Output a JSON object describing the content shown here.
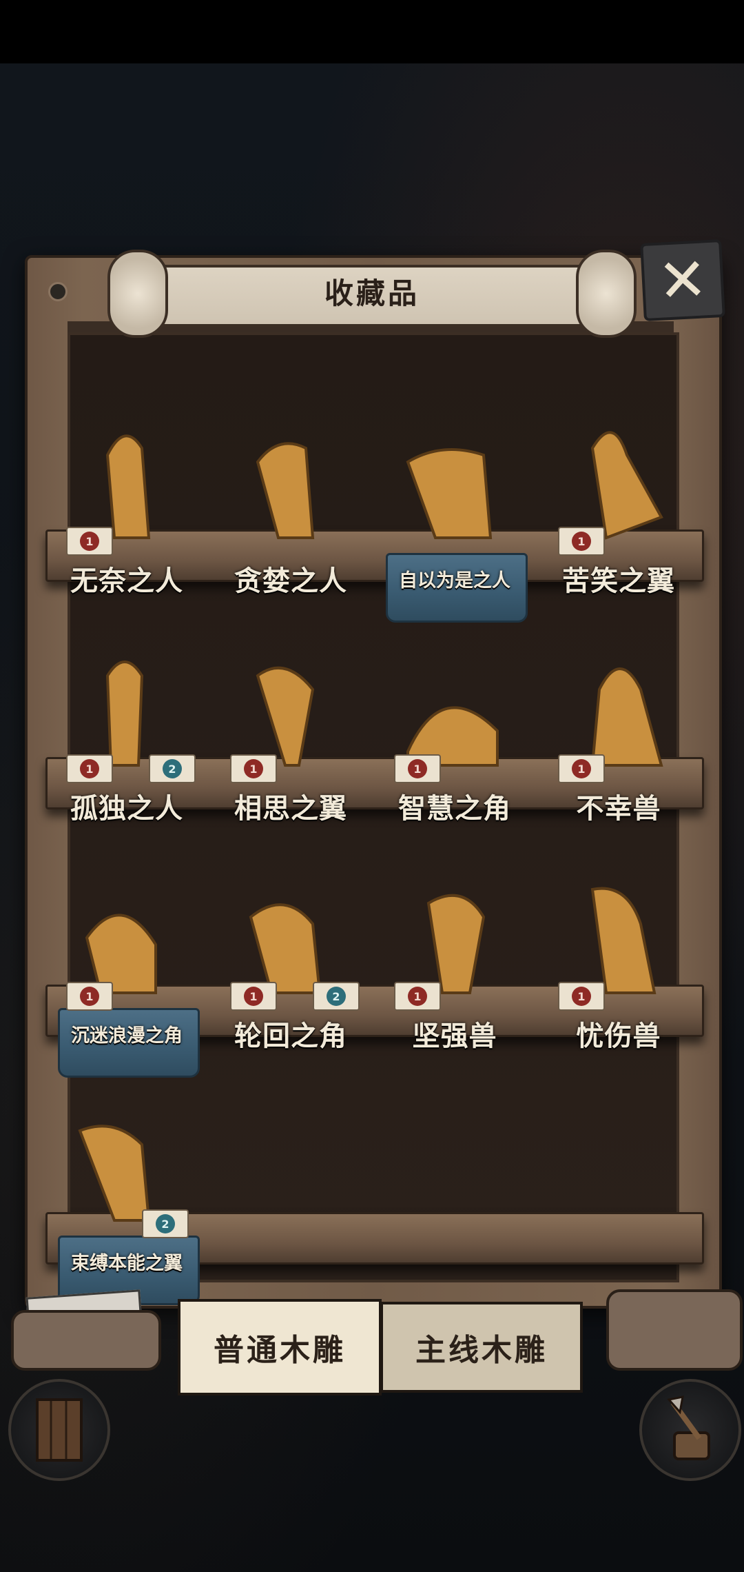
{
  "window": {
    "title": "收藏品"
  },
  "tabs": [
    {
      "label": "普通木雕",
      "active": true
    },
    {
      "label": "主线木雕",
      "active": false
    }
  ],
  "items": [
    {
      "name": "无奈之人",
      "badges": [
        {
          "kind": "red",
          "count": "1"
        }
      ],
      "plate": false
    },
    {
      "name": "贪婪之人",
      "badges": [],
      "plate": false
    },
    {
      "name": "自以为是之人",
      "badges": [],
      "plate": true
    },
    {
      "name": "苦笑之翼",
      "badges": [
        {
          "kind": "red",
          "count": "1"
        }
      ],
      "plate": false
    },
    {
      "name": "孤独之人",
      "badges": [
        {
          "kind": "red",
          "count": "1"
        },
        {
          "kind": "blue",
          "count": "2"
        }
      ],
      "plate": false
    },
    {
      "name": "相思之翼",
      "badges": [
        {
          "kind": "red",
          "count": "1"
        }
      ],
      "plate": false
    },
    {
      "name": "智慧之角",
      "badges": [
        {
          "kind": "red",
          "count": "1"
        }
      ],
      "plate": false
    },
    {
      "name": "不幸兽",
      "badges": [
        {
          "kind": "red",
          "count": "1"
        }
      ],
      "plate": false
    },
    {
      "name": "沉迷浪漫之角",
      "badges": [
        {
          "kind": "red",
          "count": "1"
        }
      ],
      "plate": true
    },
    {
      "name": "轮回之角",
      "badges": [
        {
          "kind": "red",
          "count": "1"
        },
        {
          "kind": "blue",
          "count": "2"
        }
      ],
      "plate": false
    },
    {
      "name": "坚强兽",
      "badges": [
        {
          "kind": "red",
          "count": "1"
        }
      ],
      "plate": false
    },
    {
      "name": "忧伤兽",
      "badges": [
        {
          "kind": "red",
          "count": "1"
        }
      ],
      "plate": false
    },
    {
      "name": "束缚本能之翼",
      "badges": [
        {
          "kind": "blue",
          "count": "2"
        }
      ],
      "plate": true
    }
  ],
  "icons": {
    "close": "close-icon",
    "door": "door-icon",
    "axe": "axe-stump-icon"
  },
  "colors": {
    "wood": "#715b48",
    "statue": "#c9903f",
    "label": "#f2ead9",
    "plate": "#395a70"
  }
}
